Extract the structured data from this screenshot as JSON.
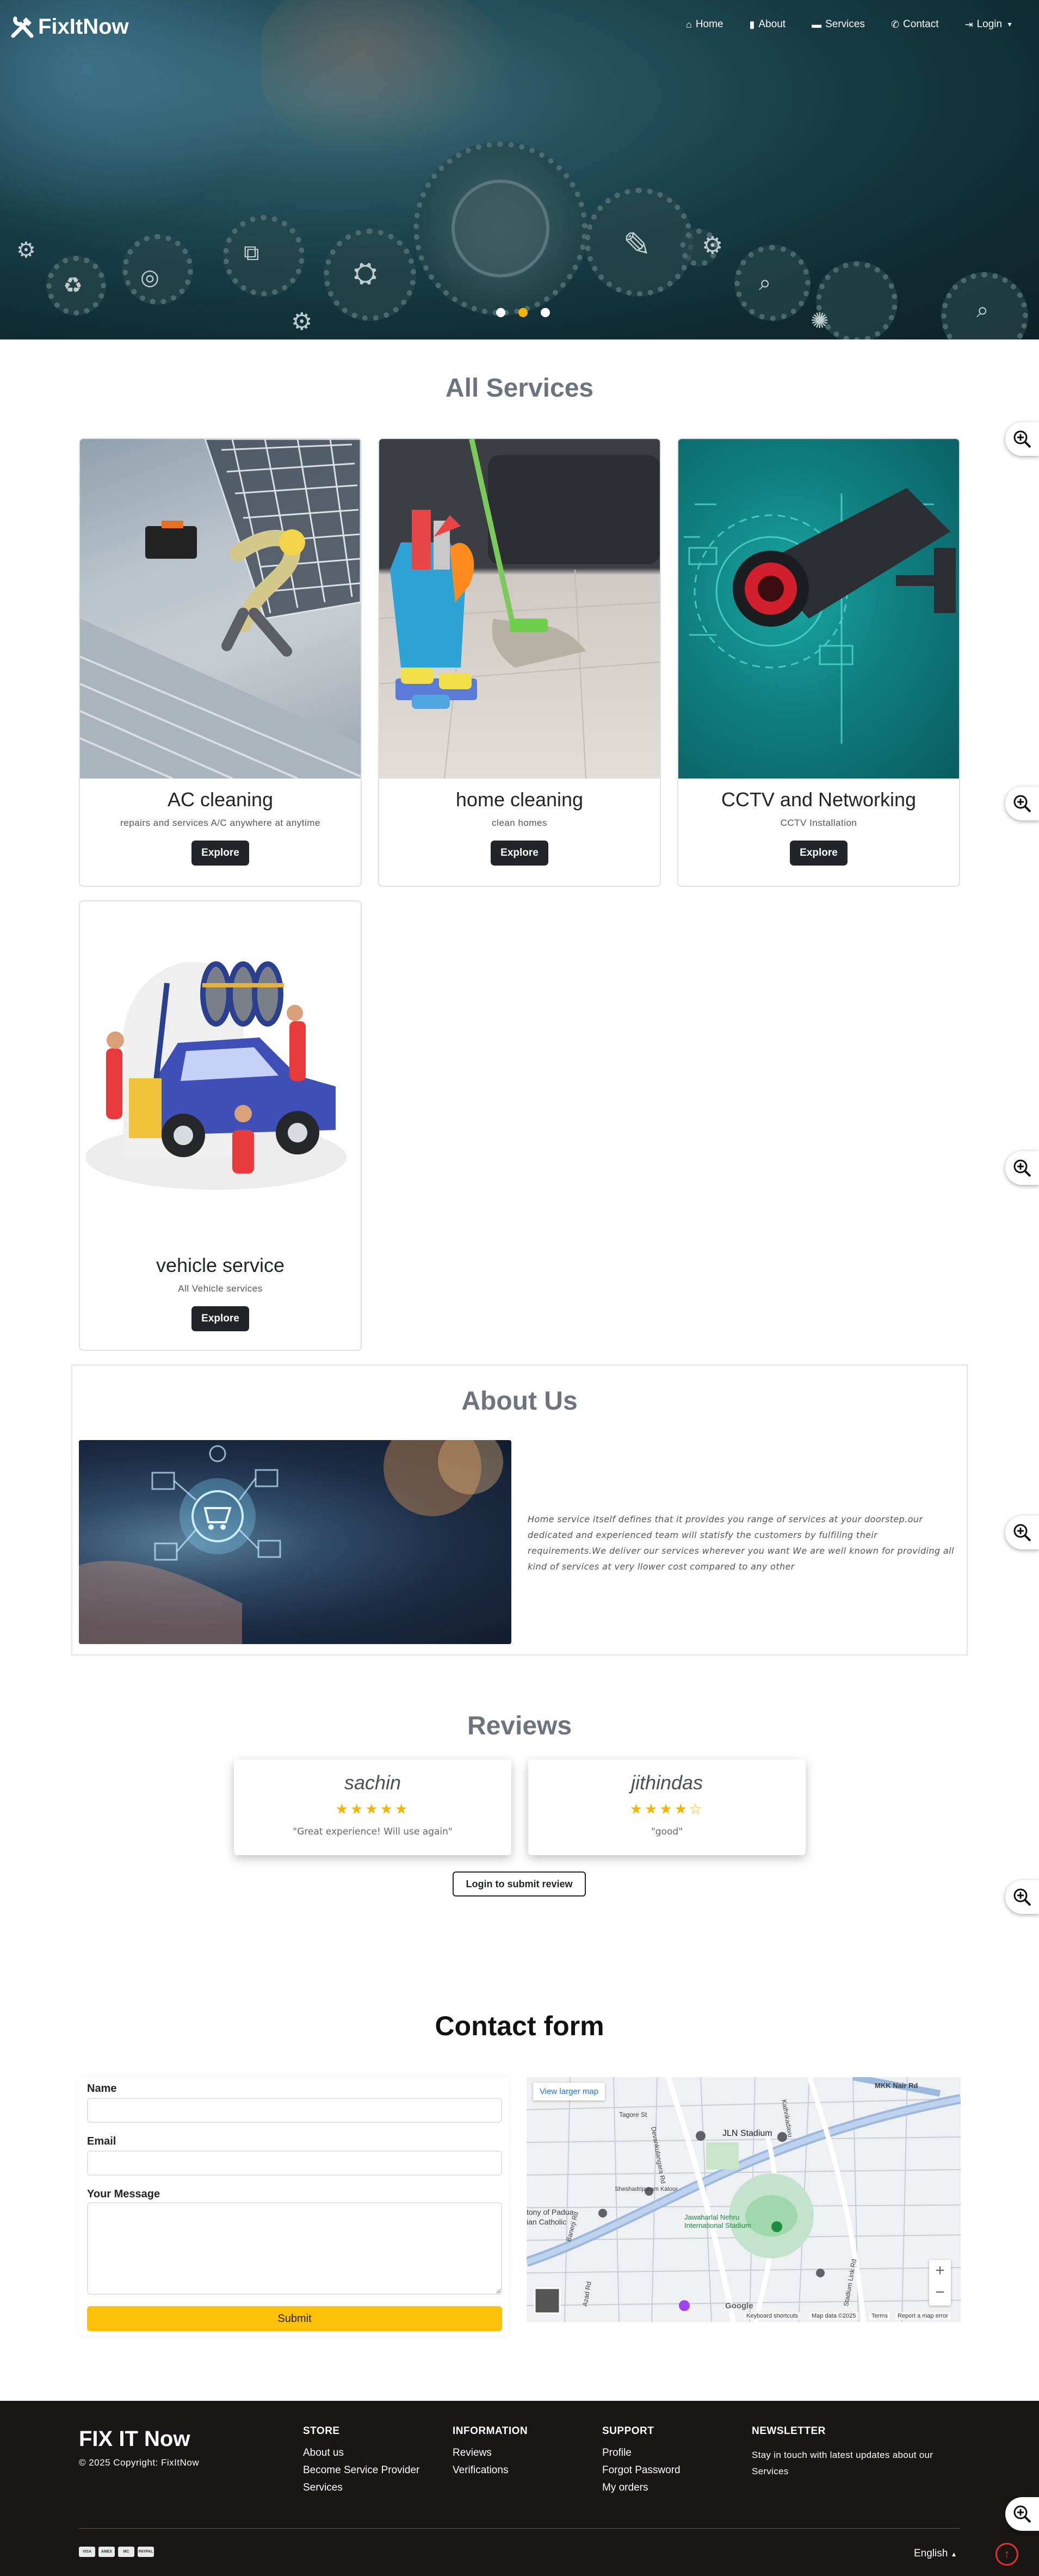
{
  "brand": {
    "name": "FixItNow"
  },
  "nav": {
    "home": "Home",
    "about": "About",
    "services": "Services",
    "contact": "Contact",
    "login": "Login"
  },
  "carousel": {
    "slides": 3,
    "active_index": 1
  },
  "services": {
    "title": "All Services",
    "items": [
      {
        "title": "AC cleaning",
        "desc": "repairs and services A/C anywhere at anytime",
        "button": "Explore"
      },
      {
        "title": "home cleaning",
        "desc": "clean homes",
        "button": "Explore"
      },
      {
        "title": "CCTV and Networking",
        "desc": "CCTV Installation",
        "button": "Explore"
      },
      {
        "title": "vehicle service",
        "desc": "All Vehicle services",
        "button": "Explore"
      }
    ]
  },
  "about": {
    "title": "About Us",
    "text": "Home service itself defines that it provides you range of services at your doorstep.our dedicated and experienced team will statisfy the customers by fulfiling their requirements.We deliver our services wherever you want We are well known for providing all kind of services at very llower cost compared to any other"
  },
  "reviews": {
    "title": "Reviews",
    "items": [
      {
        "name": "sachin",
        "stars": "★★★★★",
        "rating": 5,
        "quote": "\"Great experience! Will use again\""
      },
      {
        "name": "jithindas",
        "stars": "★★★★☆",
        "rating": 4,
        "quote": "\"good\""
      }
    ],
    "login_button": "Login to submit review"
  },
  "contact": {
    "title": "Contact form",
    "name_label": "Name",
    "email_label": "Email",
    "message_label": "Your Message",
    "submit": "Submit"
  },
  "map": {
    "view_larger": "View larger map",
    "labels": [
      "Tagore St",
      "MKK Nair Rd",
      "JLN Stadium",
      "Jawaharlal Nehru International Stadium",
      "Devankulangara Rd",
      "Sheshadripuram Kaloor",
      "tony of Padua",
      "ian Catholic",
      "Banerji Rd",
      "Azad Rd",
      "Stadium Link Rd",
      "Kathrikadavu"
    ],
    "attribution": [
      "Keyboard shortcuts",
      "Map data ©2025",
      "Terms",
      "Report a map error"
    ],
    "google": "Google"
  },
  "footer": {
    "brand": "FIX IT Now",
    "copyright": "© 2025 Copyright: FixItNow",
    "store": {
      "title": "STORE",
      "links": [
        "About us",
        "Become Service Provider",
        "Services"
      ]
    },
    "information": {
      "title": "INFORMATION",
      "links": [
        "Reviews",
        "Verifications"
      ]
    },
    "support": {
      "title": "SUPPORT",
      "links": [
        "Profile",
        "Forgot Password",
        "My orders"
      ]
    },
    "newsletter": {
      "title": "NEWSLETTER",
      "text": "Stay in touch with latest updates about our Services"
    },
    "payments": [
      "VISA",
      "AMEX",
      "MC",
      "PAYPAL"
    ],
    "language": "English"
  },
  "colors": {
    "accent": "#f5b400",
    "submit": "#ffc107",
    "footer_bg": "#1b1616",
    "dark_button": "#212529"
  }
}
